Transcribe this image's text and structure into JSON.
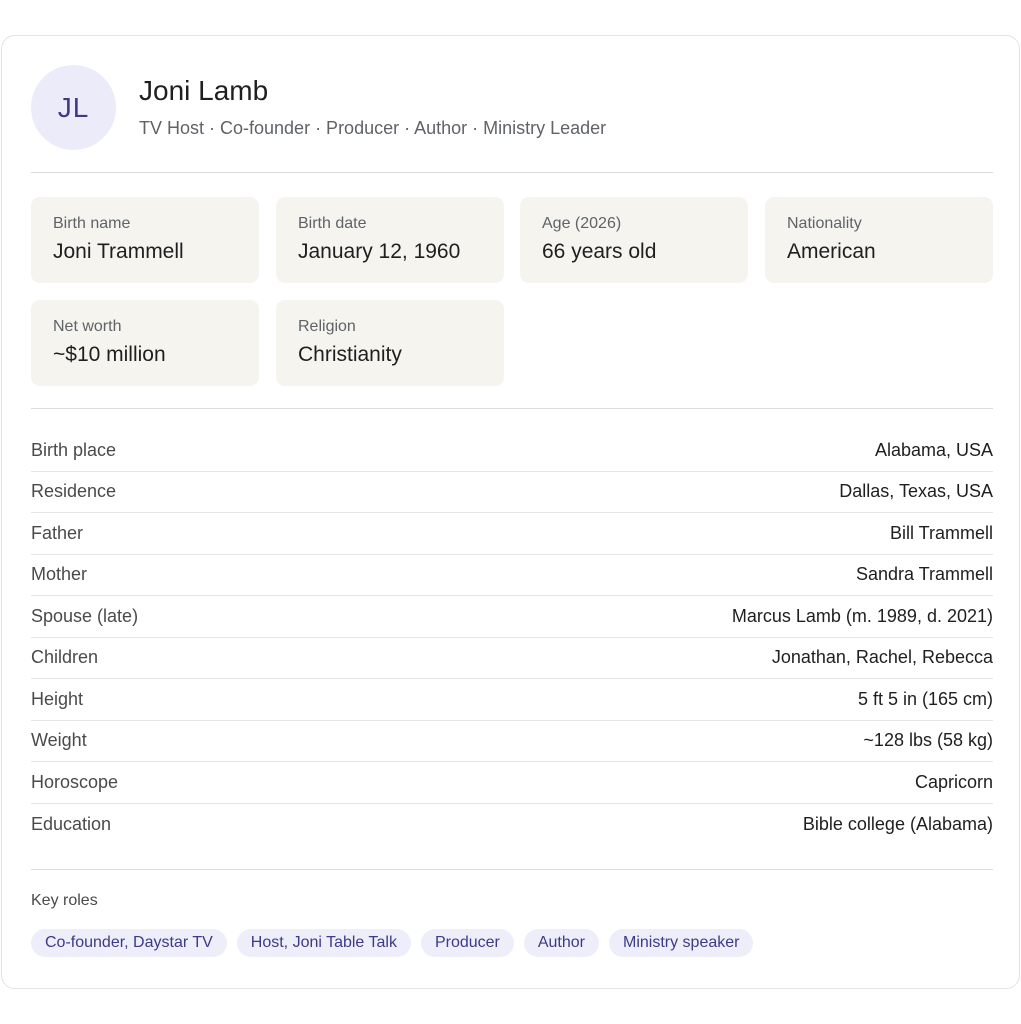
{
  "profile": {
    "initials": "JL",
    "name": "Joni Lamb",
    "subtitle": "TV Host · Co-founder · Producer · Author · Ministry Leader"
  },
  "stats": [
    {
      "label": "Birth name",
      "value": "Joni Trammell"
    },
    {
      "label": "Birth date",
      "value": "January 12, 1960"
    },
    {
      "label": "Age (2026)",
      "value": "66 years old"
    },
    {
      "label": "Nationality",
      "value": "American"
    },
    {
      "label": "Net worth",
      "value": "~$10 million"
    },
    {
      "label": "Religion",
      "value": "Christianity"
    }
  ],
  "facts": [
    {
      "label": "Birth place",
      "value": "Alabama, USA"
    },
    {
      "label": "Residence",
      "value": "Dallas, Texas, USA"
    },
    {
      "label": "Father",
      "value": "Bill Trammell"
    },
    {
      "label": "Mother",
      "value": "Sandra Trammell"
    },
    {
      "label": "Spouse (late)",
      "value": "Marcus Lamb (m. 1989, d. 2021)"
    },
    {
      "label": "Children",
      "value": "Jonathan, Rachel, Rebecca"
    },
    {
      "label": "Height",
      "value": "5 ft 5 in (165 cm)"
    },
    {
      "label": "Weight",
      "value": "~128 lbs (58 kg)"
    },
    {
      "label": "Horoscope",
      "value": "Capricorn"
    },
    {
      "label": "Education",
      "value": "Bible college (Alabama)"
    }
  ],
  "roles": {
    "title": "Key roles",
    "chips": [
      "Co-founder, Daystar TV",
      "Host, Joni Table Talk",
      "Producer",
      "Author",
      "Ministry speaker"
    ]
  },
  "colors": {
    "accent": "#3f3a86",
    "avatar_bg": "#ecebfa",
    "stat_bg": "#f5f4ef",
    "chip_bg": "#eeedfa"
  }
}
